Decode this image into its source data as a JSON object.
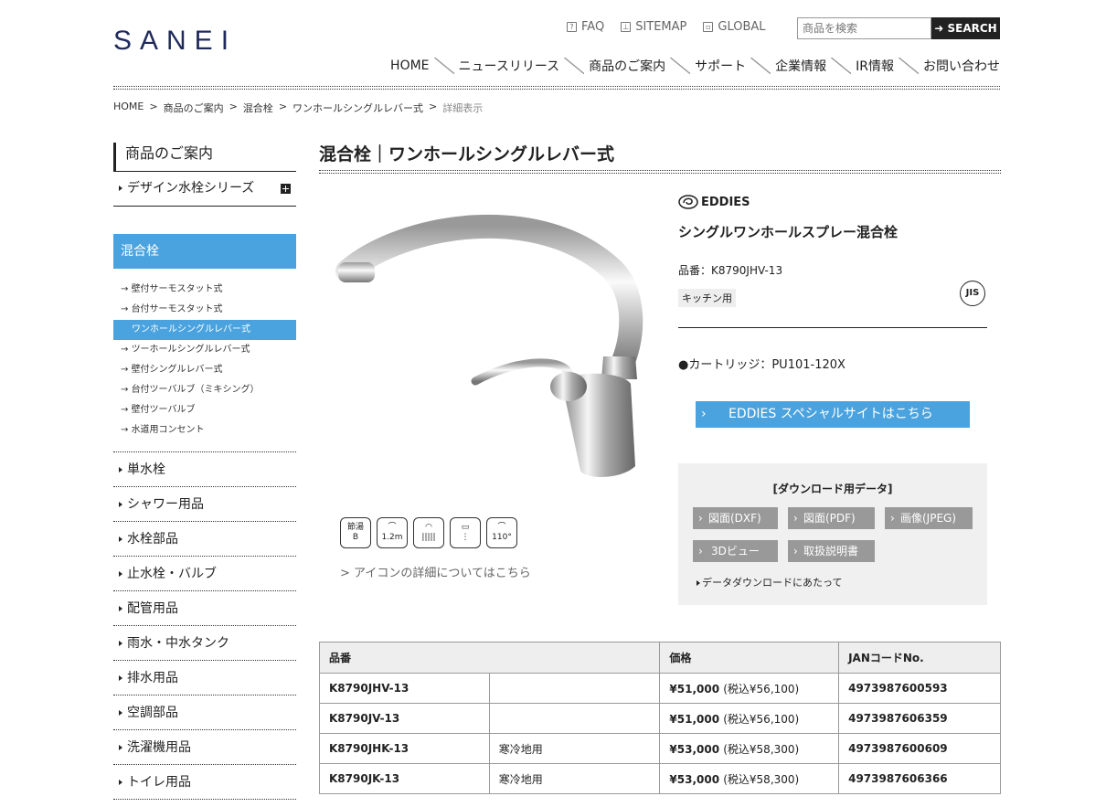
{
  "header": {
    "logo": "SANEI",
    "util": [
      {
        "icon": "question-icon",
        "label": "FAQ"
      },
      {
        "icon": "sitemap-icon",
        "label": "SITEMAP"
      },
      {
        "icon": "window-icon",
        "label": "GLOBAL"
      }
    ],
    "search": {
      "placeholder": "商品を検索",
      "button": "➜ SEARCH"
    },
    "nav": [
      "HOME",
      "ニュースリリース",
      "商品のご案内",
      "サポート",
      "企業情報",
      "IR情報",
      "お問い合わせ"
    ]
  },
  "breadcrumb": [
    "HOME",
    "商品のご案内",
    "混合栓",
    "ワンホールシングルレバー式",
    "詳細表示"
  ],
  "sidebar": {
    "title": "商品のご案内",
    "design": "デザイン水栓シリーズ",
    "active": "混合栓",
    "sub": [
      "壁付サーモスタット式",
      "台付サーモスタット式",
      "ワンホールシングルレバー式",
      "ツーホールシングルレバー式",
      "壁付シングルレバー式",
      "台付ツーバルブ（ミキシング）",
      "壁付ツーバルブ",
      "水道用コンセント"
    ],
    "cats": [
      "単水栓",
      "シャワー用品",
      "水栓部品",
      "止水栓・バルブ",
      "配管用品",
      "雨水・中水タンク",
      "排水用品",
      "空調部品",
      "洗濯機用品",
      "トイレ用品"
    ]
  },
  "main": {
    "title": "混合栓｜ワンホールシングルレバー式",
    "brand": "EDDIES",
    "product_name": "シングルワンホールスプレー混合栓",
    "product_code": "品番：K8790JHV-13",
    "tag": "キッチン用",
    "jis": "JIS",
    "cartridge": "●カートリッジ：PU101-120X",
    "eddies_button": "EDDIES スペシャルサイトはこちら",
    "icons": [
      {
        "l1": "節湯",
        "l2": "B"
      },
      {
        "l1": "",
        "l2": "1.2m"
      },
      {
        "l1": "",
        "l2": ""
      },
      {
        "l1": "",
        "l2": ""
      },
      {
        "l1": "",
        "l2": "110°"
      }
    ],
    "icon_link": "> アイコンの詳細についてはこちら",
    "download": {
      "title": "[ダウンロード用データ]",
      "buttons": [
        "図面(DXF)",
        "図面(PDF)",
        "画像(JPEG)",
        "3Dビュー",
        "取扱説明書"
      ],
      "note": "データダウンロードにあたって"
    }
  },
  "table": {
    "headers": [
      "品番",
      "価格",
      "JANコードNo."
    ],
    "rows": [
      {
        "code": "K8790JHV-13",
        "note": "",
        "price": "¥51,000",
        "tax": "(税込¥56,100)",
        "jan": "4973987600593"
      },
      {
        "code": "K8790JV-13",
        "note": "",
        "price": "¥51,000",
        "tax": "(税込¥56,100)",
        "jan": "4973987606359"
      },
      {
        "code": "K8790JHK-13",
        "note": "寒冷地用",
        "price": "¥53,000",
        "tax": "(税込¥58,300)",
        "jan": "4973987600609"
      },
      {
        "code": "K8790JK-13",
        "note": "寒冷地用",
        "price": "¥53,000",
        "tax": "(税込¥58,300)",
        "jan": "4973987606366"
      }
    ]
  }
}
